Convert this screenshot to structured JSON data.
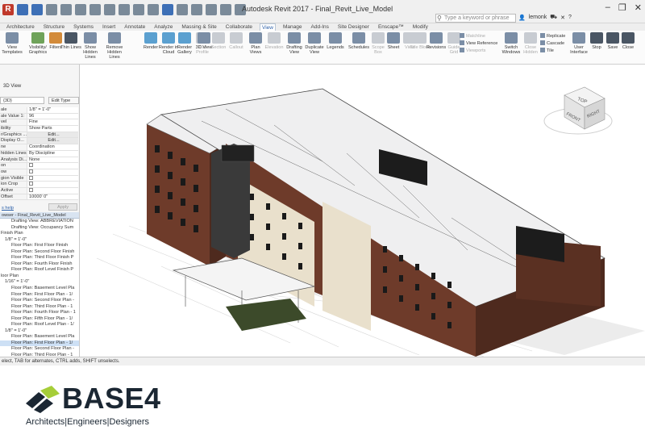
{
  "window": {
    "title": "Autodesk Revit 2017 -  Final_Revit_Live_Model",
    "search_placeholder": "Type a keyword or phrase",
    "user": "lemonk"
  },
  "ribbon_tabs": [
    "Architecture",
    "Structure",
    "Systems",
    "Insert",
    "Annotate",
    "Analyze",
    "Massing & Site",
    "Collaborate",
    "View",
    "Manage",
    "Add-Ins",
    "Site Designer",
    "Enscape™",
    "Modify"
  ],
  "active_tab": "View",
  "ribbon": {
    "view_templates": "View\nTemplates",
    "visibility_graphics": "Visibility/\nGraphics",
    "filters": "Filters",
    "thin_lines": "Thin\nLines",
    "show_hidden_lines": "Show\nHidden Lines",
    "remove_hidden_lines": "Remove\nHidden Lines",
    "render": "Render",
    "render_in_cloud": "Render\nin Cloud",
    "render_gallery": "Render\nGallery",
    "cut_profile": "Cut\nProfile",
    "view_3d": "3D\nView",
    "section": "Section",
    "callout": "Callout",
    "plan_views": "Plan\nViews",
    "elevation": "Elevation",
    "drafting_view": "Drafting\nView",
    "duplicate_view": "Duplicate\nView",
    "legends": "Legends",
    "schedules": "Schedules",
    "scope_box": "Scope\nBox",
    "sheet": "Sheet",
    "view": "View",
    "title_block": "Title\nBlock",
    "revisions": "Revisions",
    "guide_grid": "Guide\nGrid",
    "matchline": "Matchline",
    "view_reference": "View Reference",
    "viewports": "Viewports",
    "switch_windows": "Switch\nWindows",
    "close_hidden": "Close\nHidden",
    "replicate": "Replicate",
    "cascade": "Cascade",
    "tile": "Tile",
    "user_interface": "User\nInterface",
    "stop": "Stop",
    "save": "Save",
    "close": "Close"
  },
  "properties": {
    "view_type": "3D View",
    "type_selector": "{3D}",
    "edit_type": "Edit Type",
    "rows": [
      {
        "key": "ale",
        "value": "1/8\" = 1'-0\""
      },
      {
        "key": "ale Value  1:",
        "value": "96"
      },
      {
        "key": "vel",
        "value": "Fine"
      },
      {
        "key": "ibility",
        "value": "Show Parts"
      },
      {
        "key": "r/Graphics ...",
        "value": "Edit...",
        "button": true
      },
      {
        "key": "Display O...",
        "value": "Edit...",
        "button": true
      },
      {
        "key": "ne",
        "value": "Coordination"
      },
      {
        "key": "hidden Lines",
        "value": "By Discipline"
      },
      {
        "key": "Analysis Di...",
        "value": "None"
      },
      {
        "key": "on",
        "value": ""
      },
      {
        "key": "ow",
        "value": ""
      },
      {
        "key": "gion Visible",
        "value": ""
      },
      {
        "key": "ion Crop",
        "value": ""
      },
      {
        "key": "Active",
        "value": ""
      },
      {
        "key": "Offset",
        "value": "10000' 0\""
      }
    ],
    "help": "s help",
    "apply": "Apply"
  },
  "browser": {
    "header": "owser - Final_Revit_Live_Model",
    "items": [
      "Drafting View: ABBREVIATION",
      "Drafting View: Occupancy Sum",
      "Finish Plan",
      "1/8\" = 1'-0\"",
      "Floor Plan: First Floor Finish",
      "Floor Plan: Second Floor Finish",
      "Floor Plan: Third Floor Finish P",
      "Floor Plan: Fourth Floor Finish",
      "Floor Plan: Roof Level Finish P",
      "loor Plan",
      "1/16\" = 1'-0\"",
      "Floor Plan: Basement Level Pla",
      "Floor Plan: First Floor Plan - 1/",
      "Floor Plan: Second Floor Plan -",
      "Floor Plan: Third Floor Plan - 1",
      "Floor Plan: Fourth Floor Plan - 1",
      "Floor Plan: Fifth Floor Plan - 1/",
      "Floor Plan: Roof Level Plan - 1/",
      "1/8\" = 1'-0\"",
      "Floor Plan: Basement Level Pla",
      "Floor Plan: First Floor Plan - 1/",
      "Floor Plan: Second Floor Plan -",
      "Floor Plan: Third Floor Plan - 1"
    ]
  },
  "status_text": "elect, TAB for alternates, CTRL adds, SHIFT unselects.",
  "viewcube": {
    "top": "TOP",
    "front": "FRONT",
    "right": "RIGHT"
  },
  "brand": {
    "name": "BASE4",
    "tagline": "Architects|Engineers|Designers",
    "colors": {
      "mark_light": "#a6ce39",
      "mark_dark": "#1b2733"
    }
  },
  "colors": {
    "brick": "#6e3b2a",
    "cream": "#e9e0cc",
    "roof": "#efeff0",
    "accent_tab": "#2a5fa8"
  }
}
